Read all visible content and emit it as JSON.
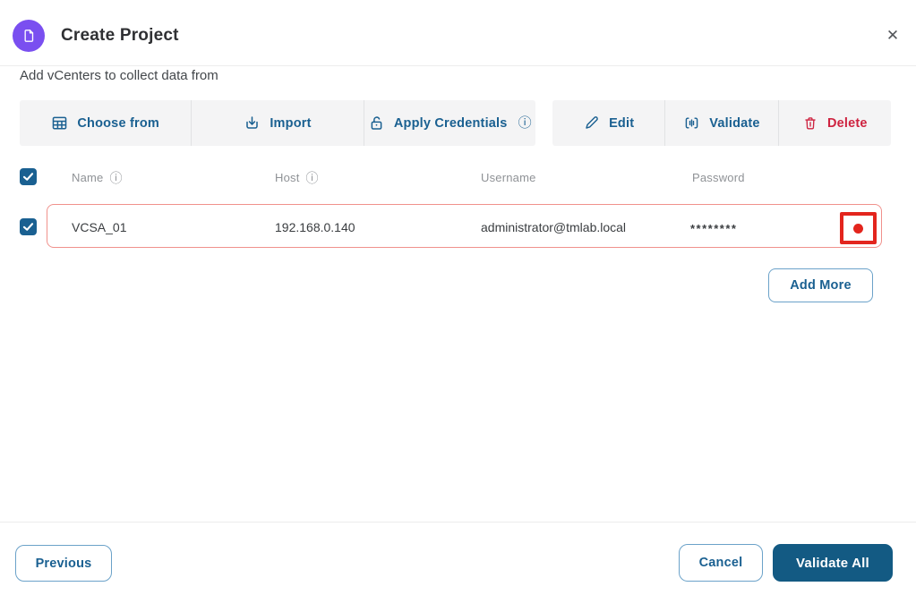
{
  "modal": {
    "title": "Create Project",
    "subtitle": "Add vCenters to collect data from",
    "close_glyph": "✕"
  },
  "toolbar": {
    "choose_from": "Choose from",
    "import": "Import",
    "apply_credentials": "Apply Credentials",
    "edit": "Edit",
    "validate": "Validate",
    "delete": "Delete",
    "info_glyph": "ⓘ"
  },
  "table": {
    "headers": {
      "name": "Name",
      "host": "Host",
      "username": "Username",
      "password": "Password",
      "info_glyph": "ⓘ"
    },
    "row": {
      "name": "VCSA_01",
      "host": "192.168.0.140",
      "username": "administrator@tmlab.local",
      "password": "********",
      "selected": true,
      "status": "error"
    }
  },
  "buttons": {
    "add_more": "Add More",
    "previous": "Previous",
    "cancel": "Cancel",
    "validate_all": "Validate All"
  },
  "colors": {
    "accent_blue": "#1a6091",
    "primary_button_bg": "#135a83",
    "delete_red": "#ce2340",
    "row_error_border": "#f0918c",
    "annotation_red": "#e3251d",
    "header_icon_purple": "#7a4ff0",
    "toolbar_bg": "#f4f4f5"
  }
}
